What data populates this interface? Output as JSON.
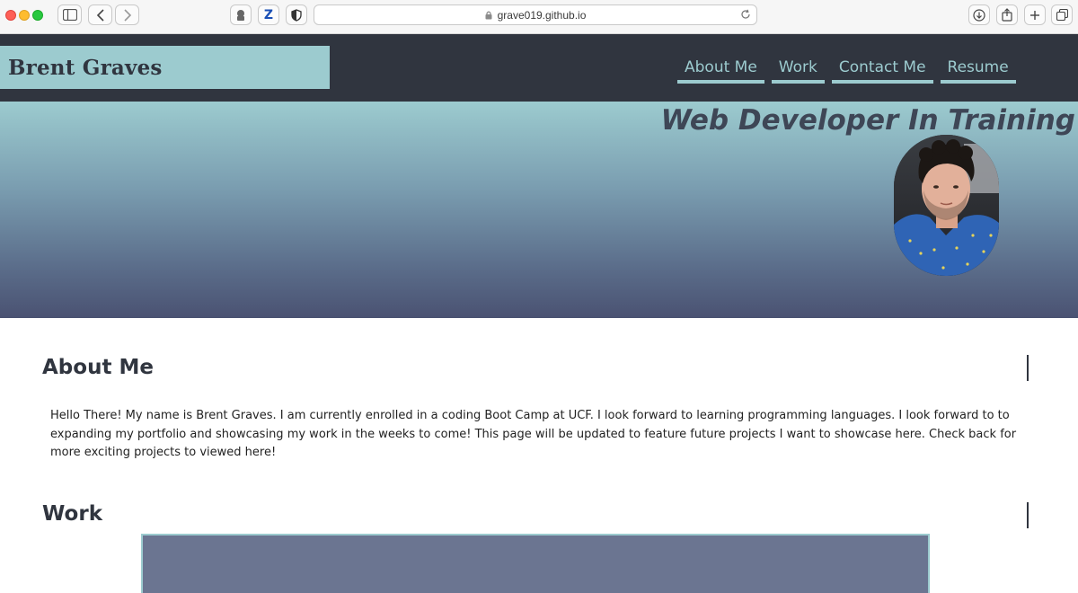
{
  "browser": {
    "url": "grave019.github.io"
  },
  "header": {
    "brand": "Brent Graves",
    "nav": [
      {
        "label": "About Me"
      },
      {
        "label": "Work"
      },
      {
        "label": "Contact Me"
      },
      {
        "label": "Resume"
      }
    ]
  },
  "hero": {
    "tagline": "Web Developer In Training"
  },
  "about": {
    "title": "About Me",
    "body": "Hello There! My name is Brent Graves. I am currently enrolled in a coding Boot Camp at UCF. I look forward to learning programming languages. I look forward to to expanding my portfolio and showcasing my work in the weeks to come! This page will be updated to feature future projects I want to showcase here. Check back for more exciting projects to viewed here!"
  },
  "work": {
    "title": "Work"
  },
  "colors": {
    "header_bg": "#30353f",
    "accent": "#9ccbcf",
    "hero_bottom": "#4a5272",
    "work_box": "#6b7591"
  },
  "icons": [
    "sidebar-icon",
    "back-icon",
    "forward-icon",
    "extension-icon",
    "zotero-icon",
    "shield-icon",
    "lock-icon",
    "reload-icon",
    "download-icon",
    "share-icon",
    "new-tab-icon",
    "tabs-icon"
  ]
}
